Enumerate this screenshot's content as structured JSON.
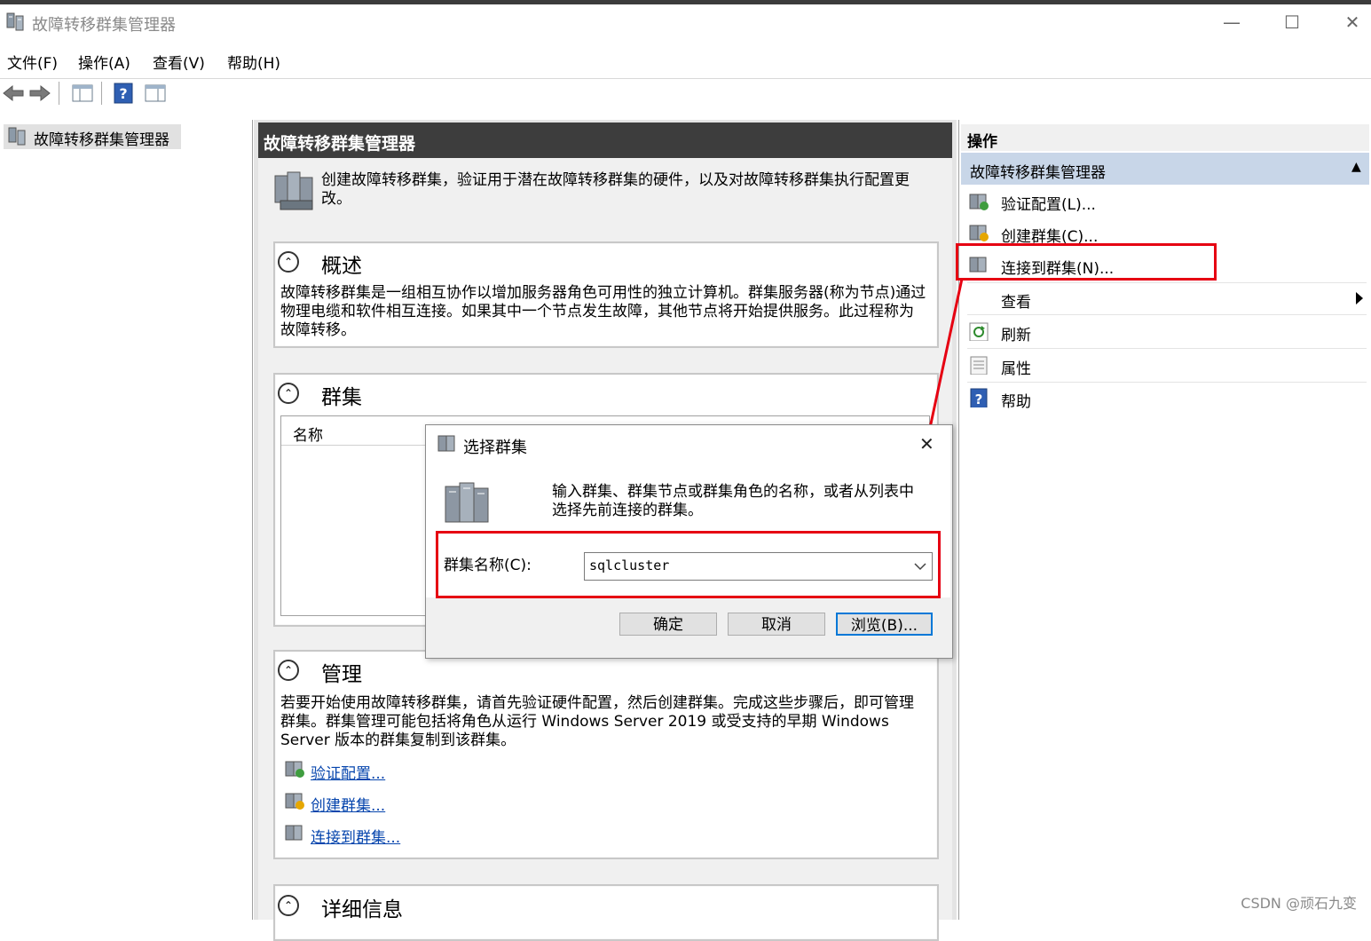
{
  "window": {
    "title": "故障转移群集管理器",
    "minimize_label": "—",
    "maximize_label": "☐",
    "close_label": "✕"
  },
  "menu": {
    "file": "文件(F)",
    "action": "操作(A)",
    "view": "查看(V)",
    "help": "帮助(H)"
  },
  "tree": {
    "root_label": "故障转移群集管理器"
  },
  "center": {
    "header": "故障转移群集管理器",
    "intro": "创建故障转移群集，验证用于潜在故障转移群集的硬件，以及对故障转移群集执行配置更改。",
    "overview": {
      "title": "概述",
      "text": "故障转移群集是一组相互协作以增加服务器角色可用性的独立计算机。群集服务器(称为节点)通过物理电缆和软件相互连接。如果其中一个节点发生故障，其他节点将开始提供服务。此过程称为故障转移。"
    },
    "clusters": {
      "title": "群集",
      "column_name": "名称"
    },
    "manage": {
      "title": "管理",
      "text": "若要开始使用故障转移群集，请首先验证硬件配置，然后创建群集。完成这些步骤后，即可管理群集。群集管理可能包括将角色从运行 Windows Server 2019 或受支持的早期 Windows Server 版本的群集复制到该群集。",
      "link_validate": "验证配置...",
      "link_create": "创建群集...",
      "link_connect": "连接到群集..."
    },
    "details": {
      "title": "详细信息"
    }
  },
  "actions": {
    "header": "操作",
    "subheader": "故障转移群集管理器",
    "items": [
      {
        "label": "验证配置(L)..."
      },
      {
        "label": "创建群集(C)..."
      },
      {
        "label": "连接到群集(N)..."
      },
      {
        "label": "查看"
      },
      {
        "label": "刷新"
      },
      {
        "label": "属性"
      },
      {
        "label": "帮助"
      }
    ]
  },
  "dialog": {
    "title": "选择群集",
    "close_label": "✕",
    "message": "输入群集、群集节点或群集角色的名称，或者从列表中选择先前连接的群集。",
    "field_label": "群集名称(C):",
    "field_value": "sqlcluster",
    "ok": "确定",
    "cancel": "取消",
    "browse": "浏览(B)..."
  },
  "watermark": "CSDN @顽石九变",
  "colors": {
    "highlight_red": "#e60012",
    "header_dark": "#3d3d3d",
    "action_sub_bg": "#c8d6e8",
    "link": "#0645ad"
  }
}
